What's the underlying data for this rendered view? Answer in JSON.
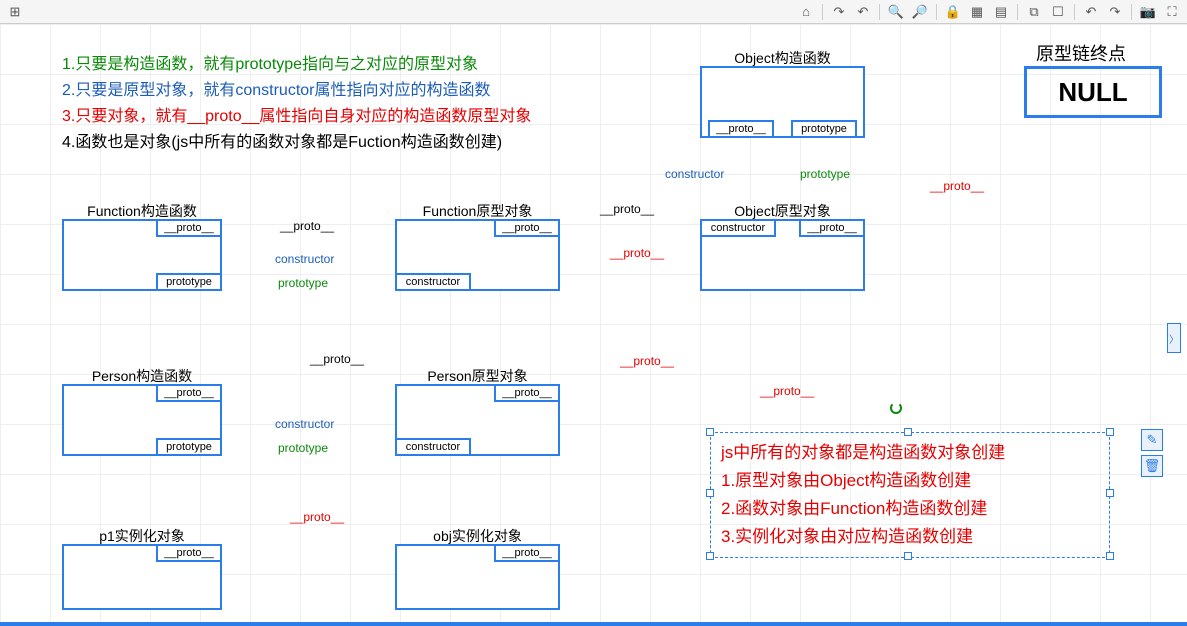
{
  "toolbar": {
    "ruler": "⊞",
    "home": "⌂",
    "redo2": "↷",
    "undo2": "↶",
    "zoomin": "🔍+",
    "zoomout": "🔍−",
    "lock": "🔒",
    "grid": "▦",
    "layers": "▤",
    "copy": "⧉",
    "select": "☐",
    "undo": "↶",
    "redo": "↷",
    "camera": "📷",
    "full": "⛶"
  },
  "notes": {
    "n1": "1.只要是构造函数，就有prototype指向与之对应的原型对象",
    "n2": "2.只要是原型对象，就有constructor属性指向对应的构造函数",
    "n3": "3.只要对象，就有__proto__属性指向自身对应的构造函数原型对象",
    "n4": "4.函数也是对象(js中所有的函数对象都是Fuction构造函数创建)"
  },
  "nullbox": {
    "title": "原型链终点",
    "text": "NULL"
  },
  "boxes": {
    "objCtor": {
      "title": "Object构造函数",
      "proto": "__proto__",
      "prototype": "prototype"
    },
    "funcCtor": {
      "title": "Function构造函数",
      "proto": "__proto__",
      "prototype": "prototype"
    },
    "funcProto": {
      "title": "Function原型对象",
      "proto": "__proto__",
      "constructor": "constructor"
    },
    "objProto": {
      "title": "Object原型对象",
      "constructor": "constructor",
      "proto": "__proto__"
    },
    "personCtor": {
      "title": "Person构造函数",
      "proto": "__proto__",
      "prototype": "prototype"
    },
    "personProto": {
      "title": "Person原型对象",
      "proto": "__proto__",
      "constructor": "constructor"
    },
    "p1": {
      "title": "p1实例化对象",
      "proto": "__proto__"
    },
    "objInst": {
      "title": "obj实例化对象",
      "proto": "__proto__"
    }
  },
  "labels": {
    "proto": "__proto__",
    "constructor": "constructor",
    "prototype": "prototype"
  },
  "textbox": {
    "l1": "js中所有的对象都是构造函数对象创建",
    "l2": "1.原型对象由Object构造函数创建",
    "l3": "2.函数对象由Function构造函数创建",
    "l4": "3.实例化对象由对应构造函数创建"
  },
  "sidebtns": {
    "edit": "✎",
    "del": "🗑"
  },
  "chevron": "〉"
}
